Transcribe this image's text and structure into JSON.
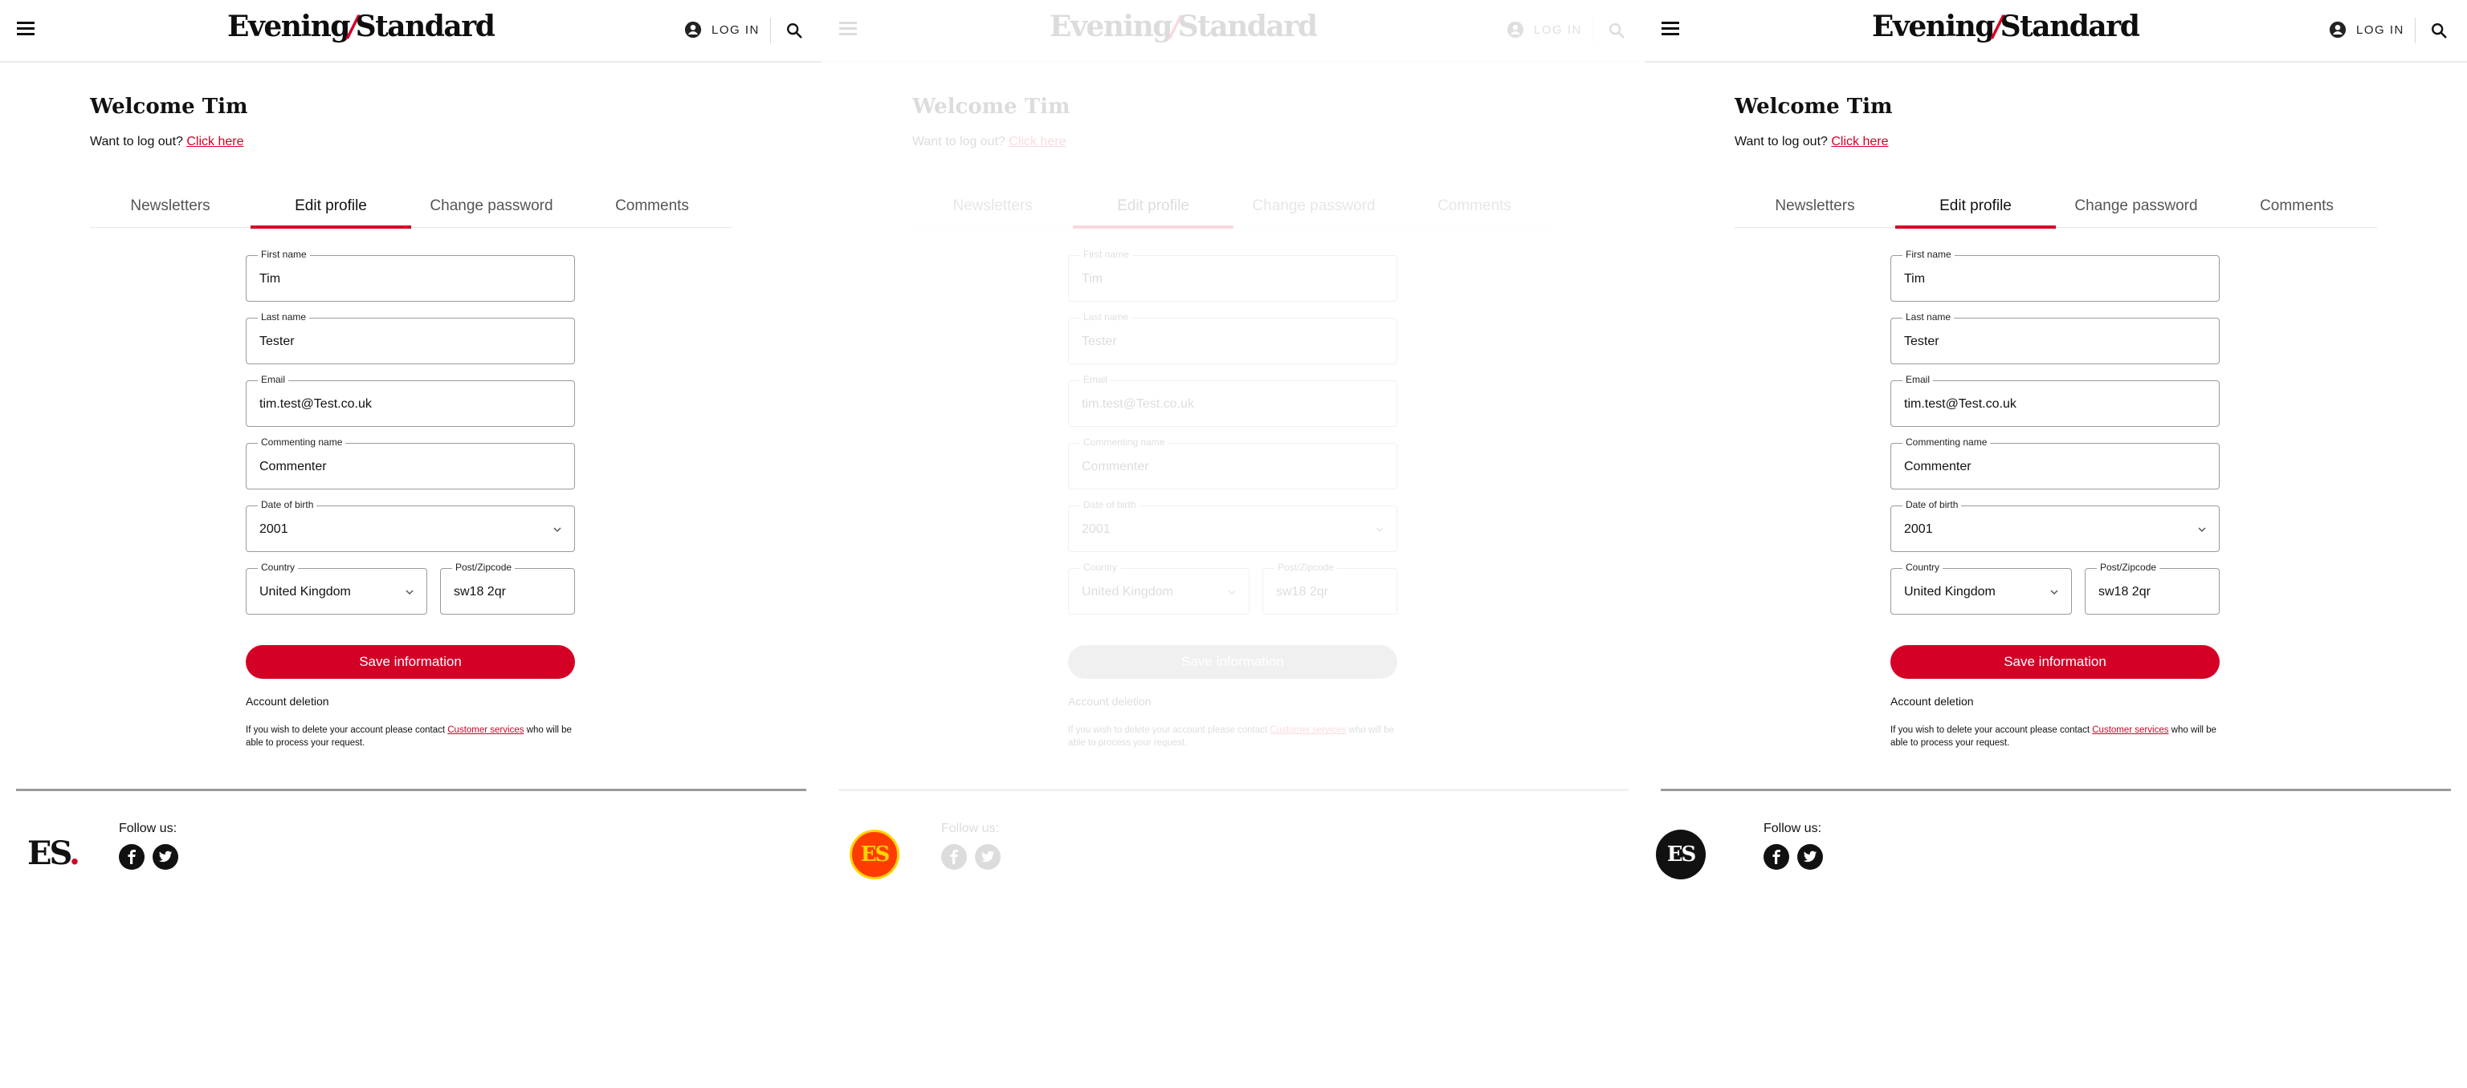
{
  "header": {
    "brand_left": "Evening",
    "brand_slash": "/",
    "brand_right": "Standard",
    "login_label": "LOG IN"
  },
  "welcome": {
    "title": "Welcome Tim",
    "logout_prompt": "Want to log out?",
    "logout_link": "Click here"
  },
  "tabs": [
    {
      "label": "Newsletters",
      "active": false
    },
    {
      "label": "Edit profile",
      "active": true
    },
    {
      "label": "Change password",
      "active": false
    },
    {
      "label": "Comments",
      "active": false
    }
  ],
  "form": {
    "first_name": {
      "label": "First name",
      "value": "Tim"
    },
    "last_name": {
      "label": "Last name",
      "value": "Tester"
    },
    "email": {
      "label": "Email",
      "value": "tim.test@Test.co.uk"
    },
    "commenting_name": {
      "label": "Commenting name",
      "value": "Commenter"
    },
    "dob": {
      "label": "Date of birth",
      "value": "2001"
    },
    "country": {
      "label": "Country",
      "value": "United Kingdom"
    },
    "postcode": {
      "label": "Post/Zipcode",
      "value": "sw18 2qr"
    },
    "save_label": "Save information",
    "deletion_title": "Account deletion",
    "deletion_text_before": "If you wish to delete your account please contact",
    "deletion_link": "Customer services",
    "deletion_text_after": "who will be able to process your request."
  },
  "footer": {
    "follow_label": "Follow us:",
    "logo_text": "ES",
    "logo_dot": "."
  },
  "colors": {
    "accent": "#d40026",
    "badge_gold_bg": "#ff3c00",
    "badge_dark_bg": "#111111"
  },
  "icons": [
    "hamburger-icon",
    "user-icon",
    "search-icon",
    "chevron-down-icon",
    "facebook-icon",
    "twitter-icon"
  ]
}
